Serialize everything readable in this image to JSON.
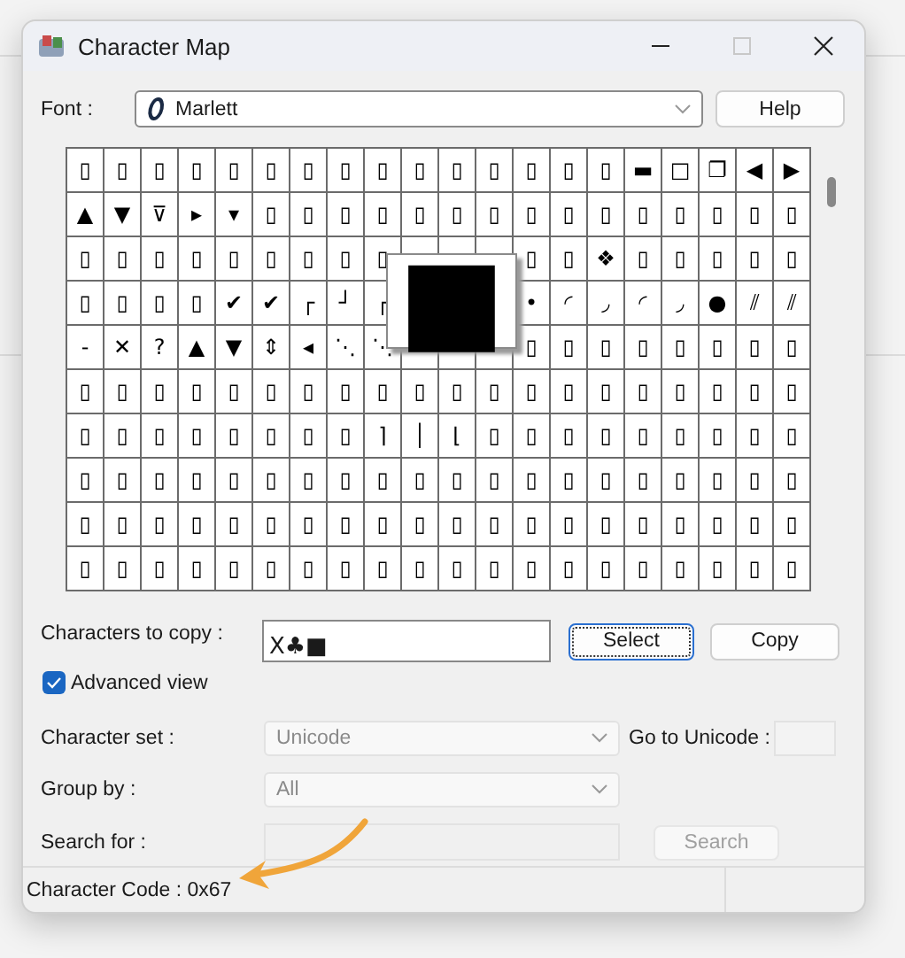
{
  "window": {
    "title": "Character Map"
  },
  "font": {
    "label": "Font :",
    "value": "Marlett",
    "button": "Help"
  },
  "grid": {
    "rows": [
      [
        "▯",
        "▯",
        "▯",
        "▯",
        "▯",
        "▯",
        "▯",
        "▯",
        "▯",
        "▯",
        "▯",
        "▯",
        "▯",
        "▯",
        "▯",
        "▬",
        "□",
        "❐",
        "◀",
        "▶"
      ],
      [
        "▲",
        "▼",
        "⊽",
        "▸",
        "▾",
        "▯",
        "▯",
        "▯",
        "▯",
        "▯",
        "▯",
        "▯",
        "▯",
        "▯",
        "▯",
        "▯",
        "▯",
        "▯",
        "▯",
        "▯"
      ],
      [
        "▯",
        "▯",
        "▯",
        "▯",
        "▯",
        "▯",
        "▯",
        "▯",
        "▯",
        {
          "kind": "covered"
        },
        {
          "kind": "covered"
        },
        {
          "kind": "covered"
        },
        "▯",
        "▯",
        "❖",
        "▯",
        "▯",
        "▯",
        "▯",
        "▯"
      ],
      [
        "▯",
        "▯",
        "▯",
        "▯",
        "✔",
        "✔",
        "┌",
        "┘",
        "┌",
        null,
        null,
        null,
        "•",
        "◜",
        "◞",
        "◜",
        "◞",
        "●",
        "⫽",
        "⫽"
      ],
      [
        "-",
        "✕",
        "?",
        "▲",
        "▼",
        "⇕",
        "◂",
        "⋱",
        "⋱",
        {
          "kind": "covered"
        },
        {
          "kind": "covered"
        },
        {
          "kind": "covered"
        },
        "▯",
        "▯",
        "▯",
        "▯",
        "▯",
        "▯",
        "▯",
        "▯"
      ],
      [
        "▯",
        "▯",
        "▯",
        "▯",
        "▯",
        "▯",
        "▯",
        "▯",
        "▯",
        "▯",
        "▯",
        "▯",
        "▯",
        "▯",
        "▯",
        "▯",
        "▯",
        "▯",
        "▯",
        "▯"
      ],
      [
        "▯",
        "▯",
        "▯",
        "▯",
        "▯",
        "▯",
        "▯",
        "▯",
        "⌉",
        "│",
        "⌊",
        "▯",
        "▯",
        "▯",
        "▯",
        "▯",
        "▯",
        "▯",
        "▯",
        "▯"
      ],
      [
        "▯",
        "▯",
        "▯",
        "▯",
        "▯",
        "▯",
        "▯",
        "▯",
        "▯",
        "▯",
        "▯",
        "▯",
        "▯",
        "▯",
        "▯",
        "▯",
        "▯",
        "▯",
        "▯",
        "▯"
      ],
      [
        "▯",
        "▯",
        "▯",
        "▯",
        "▯",
        "▯",
        "▯",
        "▯",
        "▯",
        "▯",
        "▯",
        "▯",
        "▯",
        "▯",
        "▯",
        "▯",
        "▯",
        "▯",
        "▯",
        "▯"
      ],
      [
        "▯",
        "▯",
        "▯",
        "▯",
        "▯",
        "▯",
        "▯",
        "▯",
        "▯",
        "▯",
        "▯",
        "▯",
        "▯",
        "▯",
        "▯",
        "▯",
        "▯",
        "▯",
        "▯",
        "▯"
      ]
    ],
    "magnified": "■"
  },
  "copy": {
    "label": "Characters to copy :",
    "value": "X♣■"
  },
  "buttons": [
    {
      "label": "Select",
      "focused": true
    },
    {
      "label": "Copy",
      "focused": false
    }
  ],
  "advanced_view": {
    "label": "Advanced view",
    "checked": true
  },
  "character_set": {
    "label": "Character set :",
    "value": "Unicode",
    "disabled": true
  },
  "go_to_unicode": {
    "label": "Go to Unicode :"
  },
  "group_by": {
    "label": "Group by :",
    "value": "All",
    "disabled": true
  },
  "search": {
    "label": "Search for :",
    "button": "Search",
    "disabled": true
  },
  "status_bar": {
    "text": "Character Code : 0x67"
  },
  "annotation": {
    "kind": "arrow"
  }
}
